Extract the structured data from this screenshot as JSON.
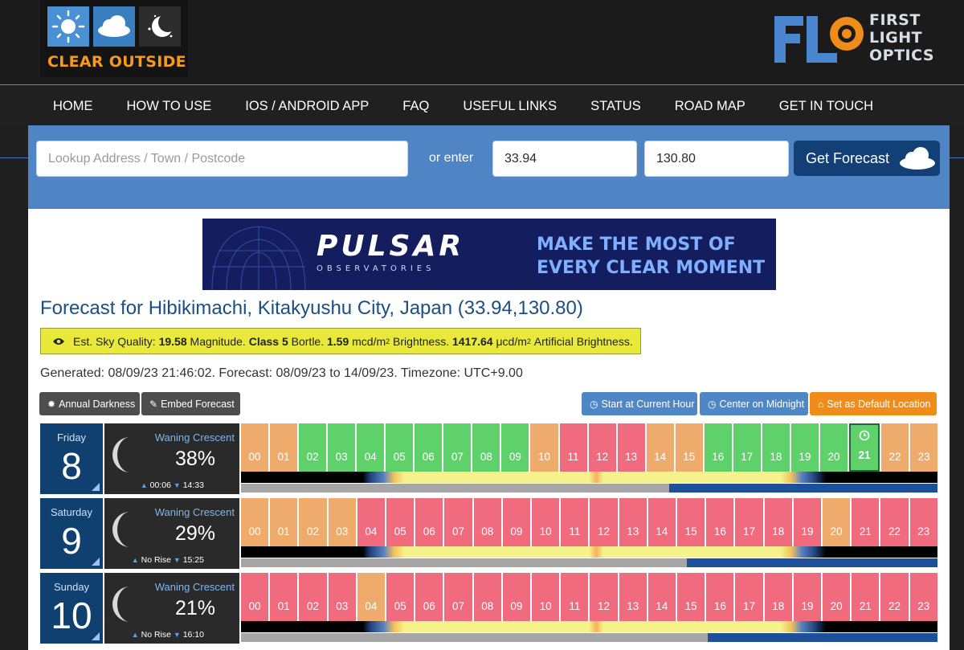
{
  "brand": {
    "name": "CLEAR OUTSIDE",
    "partner_lines": [
      "FIRST",
      "LIGHT",
      "OPTICS"
    ]
  },
  "nav": [
    "HOME",
    "HOW TO USE",
    "IOS / ANDROID APP",
    "FAQ",
    "USEFUL LINKS",
    "STATUS",
    "ROAD MAP",
    "GET IN TOUCH"
  ],
  "search": {
    "placeholder": "Lookup Address / Town / Postcode",
    "or_enter": "or enter",
    "latitude": "33.94",
    "longitude": "130.80",
    "button": "Get Forecast"
  },
  "banner": {
    "title": "PULSAR",
    "subtitle": "OBSERVATORIES",
    "tagline_1": "MAKE THE MOST OF",
    "tagline_2": "EVERY CLEAR MOMENT"
  },
  "forecast": {
    "title": "Forecast for Hibikimachi, Kitakyushu City, Japan (33.94,130.80)",
    "sky": {
      "label": "Est. Sky Quality:",
      "magnitude": "19.58",
      "magnitude_unit": "Magnitude.",
      "class_label": "Class",
      "class": "5",
      "class_unit": "Bortle.",
      "brightness": "1.59",
      "brightness_unit": "mcd/m",
      "brightness_label": "Brightness.",
      "artificial": "1417.64",
      "artificial_unit": "μcd/m",
      "artificial_label": "Artificial Brightness.",
      "sup": "2"
    },
    "generated": "Generated: 08/09/23 21:46:02. Forecast: 08/09/23 to 14/09/23. Timezone: UTC+9.00"
  },
  "buttons": {
    "annual": "Annual Darkness",
    "embed": "Embed Forecast",
    "current": "Start at Current Hour",
    "midnight": "Center on Midnight",
    "default": "Set as Default Location"
  },
  "hours": [
    "00",
    "01",
    "02",
    "03",
    "04",
    "05",
    "06",
    "07",
    "08",
    "09",
    "10",
    "11",
    "12",
    "13",
    "14",
    "15",
    "16",
    "17",
    "18",
    "19",
    "20",
    "21",
    "22",
    "23"
  ],
  "days": [
    {
      "day": "Friday",
      "date": "8",
      "phase": "Waning Crescent",
      "illum": "38%",
      "rise": "00:06",
      "set": "14:33",
      "ratings": [
        "o",
        "o",
        "g",
        "g",
        "g",
        "g",
        "g",
        "g",
        "g",
        "g",
        "o",
        "r",
        "r",
        "r",
        "o",
        "o",
        "g",
        "g",
        "g",
        "g",
        "g",
        "g",
        "o",
        "o"
      ],
      "current_hour": 21
    },
    {
      "day": "Saturday",
      "date": "9",
      "phase": "Waning Crescent",
      "illum": "29%",
      "rise": "No Rise",
      "set": "15:25",
      "ratings": [
        "o",
        "o",
        "o",
        "o",
        "r",
        "r",
        "r",
        "r",
        "r",
        "r",
        "r",
        "r",
        "r",
        "r",
        "r",
        "r",
        "r",
        "r",
        "r",
        "r",
        "o",
        "r",
        "r",
        "r"
      ],
      "current_hour": -1
    },
    {
      "day": "Sunday",
      "date": "10",
      "phase": "Waning Crescent",
      "illum": "21%",
      "rise": "No Rise",
      "set": "16:10",
      "ratings": [
        "r",
        "r",
        "r",
        "r",
        "o",
        "r",
        "r",
        "r",
        "r",
        "r",
        "r",
        "r",
        "r",
        "r",
        "r",
        "r",
        "r",
        "r",
        "r",
        "r",
        "r",
        "r",
        "r",
        "r"
      ],
      "current_hour": -1
    }
  ],
  "colors": {
    "good": "#5fd16b",
    "ok": "#eeab6b",
    "bad": "#ef6b7d",
    "accent": "#4f85c5",
    "header_dark": "#10406f"
  }
}
